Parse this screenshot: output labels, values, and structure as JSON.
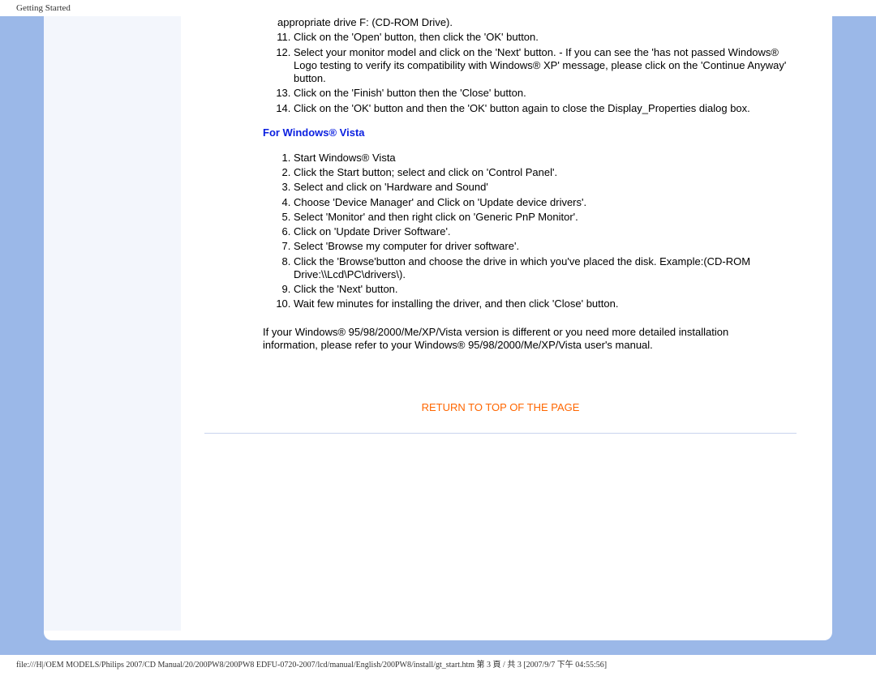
{
  "header": {
    "title": "Getting Started"
  },
  "content": {
    "xp_steps_start": 10,
    "xp_steps": [
      "appropriate drive F: (CD-ROM Drive).",
      "Click on the 'Open' button, then click the 'OK' button.",
      "Select your monitor model and click on the 'Next' button.\n- If you can see the 'has not passed Windows® Logo testing to verify its compatibility with Windows® XP' message, please click on the 'Continue Anyway' button.",
      "Click on the 'Finish' button then the 'Close' button.",
      "Click on the 'OK' button and then the 'OK' button again to close the Display_Properties dialog box."
    ],
    "vista_heading": "For Windows® Vista",
    "vista_steps": [
      "Start Windows® Vista",
      "Click the Start button; select and click on 'Control Panel'.",
      "Select and click on 'Hardware and Sound'",
      "Choose 'Device Manager' and Click on 'Update device drivers'.",
      "Select 'Monitor' and then right click on 'Generic PnP Monitor'.",
      "Click on 'Update Driver Software'.",
      "Select 'Browse my computer for driver software'.",
      "Click the 'Browse'button and choose the drive in which you've placed the disk. Example:(CD-ROM Drive:\\\\Lcd\\PC\\drivers\\).",
      "Click the 'Next' button.",
      "Wait few minutes for installing the driver, and then click 'Close' button."
    ],
    "footnote": "If your Windows® 95/98/2000/Me/XP/Vista version is different or you need more detailed installation information, please refer to your Windows® 95/98/2000/Me/XP/Vista user's manual.",
    "return_link": "RETURN TO TOP OF THE PAGE"
  },
  "footer": {
    "path": "file:///H|/OEM MODELS/Philips 2007/CD Manual/20/200PW8/200PW8 EDFU-0720-2007/lcd/manual/English/200PW8/install/gt_start.htm 第 3 頁 / 共 3  [2007/9/7 下午 04:55:56]"
  }
}
